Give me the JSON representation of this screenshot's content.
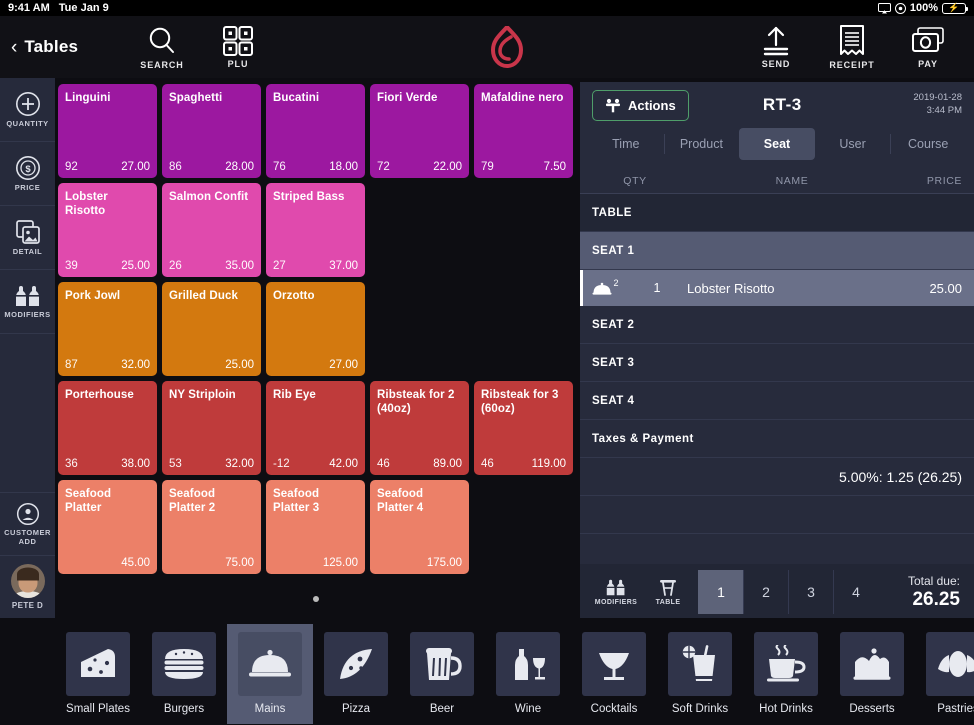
{
  "statusbar": {
    "time": "9:41 AM",
    "date": "Tue Jan 9",
    "battery_percent": "100%",
    "screen_icon": "airplay-icon",
    "location_icon": "location-icon"
  },
  "topnav": {
    "back_label": "Tables",
    "search_label": "SEARCH",
    "plu_label": "PLU",
    "send_label": "SEND",
    "receipt_label": "RECEIPT",
    "pay_label": "PAY",
    "logo": "lightspeed-flame-logo",
    "logo_color": "#c9354a"
  },
  "sidebar": {
    "items": [
      {
        "label": "QUANTITY",
        "icon": "plus-circle-icon"
      },
      {
        "label": "PRICE",
        "icon": "dollar-circle-icon"
      },
      {
        "label": "DETAIL",
        "icon": "images-icon"
      },
      {
        "label": "MODIFIERS",
        "icon": "salt-pepper-icon"
      }
    ],
    "customer_add": "CUSTOMER\nADD",
    "customer_add_line1": "CUSTOMER",
    "customer_add_line2": "ADD",
    "user_name": "PETE D"
  },
  "colors": {
    "pasta": "#9c18a0",
    "seafood_pink": "#e04aad",
    "mains_orange": "#d3790f",
    "steak_red": "#bf3b3b",
    "platter_salmon": "#ec8068",
    "accent_green": "#4f9e6a",
    "panel_bg": "#272b3c",
    "highlight": "#6a7089"
  },
  "grid": {
    "rows": [
      {
        "color_key": "pasta",
        "tiles": [
          {
            "name": "Linguini",
            "qty": "92",
            "price": "27.00"
          },
          {
            "name": "Spaghetti",
            "qty": "86",
            "price": "28.00"
          },
          {
            "name": "Bucatini",
            "qty": "76",
            "price": "18.00"
          },
          {
            "name": "Fiori Verde",
            "qty": "72",
            "price": "22.00"
          },
          {
            "name": "Mafaldine nero",
            "qty": "79",
            "price": "7.50"
          }
        ]
      },
      {
        "color_key": "seafood_pink",
        "tiles": [
          {
            "name": "Lobster Risotto",
            "qty": "39",
            "price": "25.00"
          },
          {
            "name": "Salmon Confit",
            "qty": "26",
            "price": "35.00"
          },
          {
            "name": "Striped Bass",
            "qty": "27",
            "price": "37.00"
          }
        ]
      },
      {
        "color_key": "mains_orange",
        "tiles": [
          {
            "name": "Pork Jowl",
            "qty": "87",
            "price": "32.00"
          },
          {
            "name": "Grilled Duck",
            "qty": "",
            "price": "25.00"
          },
          {
            "name": "Orzotto",
            "qty": "",
            "price": "27.00"
          }
        ]
      },
      {
        "color_key": "steak_red",
        "tiles": [
          {
            "name": "Porterhouse",
            "qty": "36",
            "price": "38.00"
          },
          {
            "name": "NY Striploin",
            "qty": "53",
            "price": "32.00"
          },
          {
            "name": "Rib Eye",
            "qty": "-12",
            "price": "42.00"
          },
          {
            "name": "Ribsteak for 2 (40oz)",
            "qty": "46",
            "price": "89.00"
          },
          {
            "name": "Ribsteak for 3 (60oz)",
            "qty": "46",
            "price": "119.00"
          }
        ]
      },
      {
        "color_key": "platter_salmon",
        "tiles": [
          {
            "name": "Seafood Platter",
            "qty": "",
            "price": "45.00"
          },
          {
            "name": "Seafood Platter 2",
            "qty": "",
            "price": "75.00"
          },
          {
            "name": "Seafood Platter 3",
            "qty": "",
            "price": "125.00"
          },
          {
            "name": "Seafood Platter 4",
            "qty": "",
            "price": "175.00"
          }
        ]
      }
    ]
  },
  "order": {
    "actions_label": "Actions",
    "actions_icon": "table-seats-icon",
    "title": "RT-3",
    "date": "2019-01-28",
    "time": "3:44 PM",
    "tabs": [
      {
        "label": "Time",
        "active": false
      },
      {
        "label": "Product",
        "active": false
      },
      {
        "label": "Seat",
        "active": true
      },
      {
        "label": "User",
        "active": false
      },
      {
        "label": "Course",
        "active": false
      }
    ],
    "columns": {
      "qty": "QTY",
      "name": "NAME",
      "price": "PRICE"
    },
    "groups": [
      {
        "label": "TABLE",
        "style": "table"
      },
      {
        "label": "SEAT 1",
        "style": "highlight"
      },
      {
        "label": "SEAT 2",
        "style": "plain"
      },
      {
        "label": "SEAT 3",
        "style": "plain"
      },
      {
        "label": "SEAT 4",
        "style": "plain"
      },
      {
        "label": "Taxes & Payment",
        "style": "plain"
      }
    ],
    "line_item": {
      "icon": "cloche-icon",
      "course": "2",
      "qty": "1",
      "name": "Lobster Risotto",
      "price": "25.00"
    },
    "tax_line": "5.00%: 1.25 (26.25)",
    "footer": {
      "modifiers_label": "MODIFIERS",
      "modifiers_icon": "salt-pepper-icon",
      "table_label": "TABLE",
      "table_icon": "table-icon",
      "seats": [
        "1",
        "2",
        "3",
        "4"
      ],
      "active_seat": "1",
      "total_label": "Total due:",
      "total_value": "26.25"
    }
  },
  "categories": [
    {
      "label": "Small Plates",
      "icon": "cheese-icon",
      "active": false
    },
    {
      "label": "Burgers",
      "icon": "burger-icon",
      "active": false
    },
    {
      "label": "Mains",
      "icon": "cloche-icon",
      "active": true
    },
    {
      "label": "Pizza",
      "icon": "pizza-icon",
      "active": false
    },
    {
      "label": "Beer",
      "icon": "beer-mug-icon",
      "active": false
    },
    {
      "label": "Wine",
      "icon": "wine-bottle-glass-icon",
      "active": false
    },
    {
      "label": "Cocktails",
      "icon": "cocktail-glass-icon",
      "active": false
    },
    {
      "label": "Soft Drinks",
      "icon": "soda-glass-icon",
      "active": false
    },
    {
      "label": "Hot Drinks",
      "icon": "coffee-cup-icon",
      "active": false
    },
    {
      "label": "Desserts",
      "icon": "cake-slice-icon",
      "active": false
    },
    {
      "label": "Pastries",
      "icon": "croissant-icon",
      "active": false
    }
  ]
}
